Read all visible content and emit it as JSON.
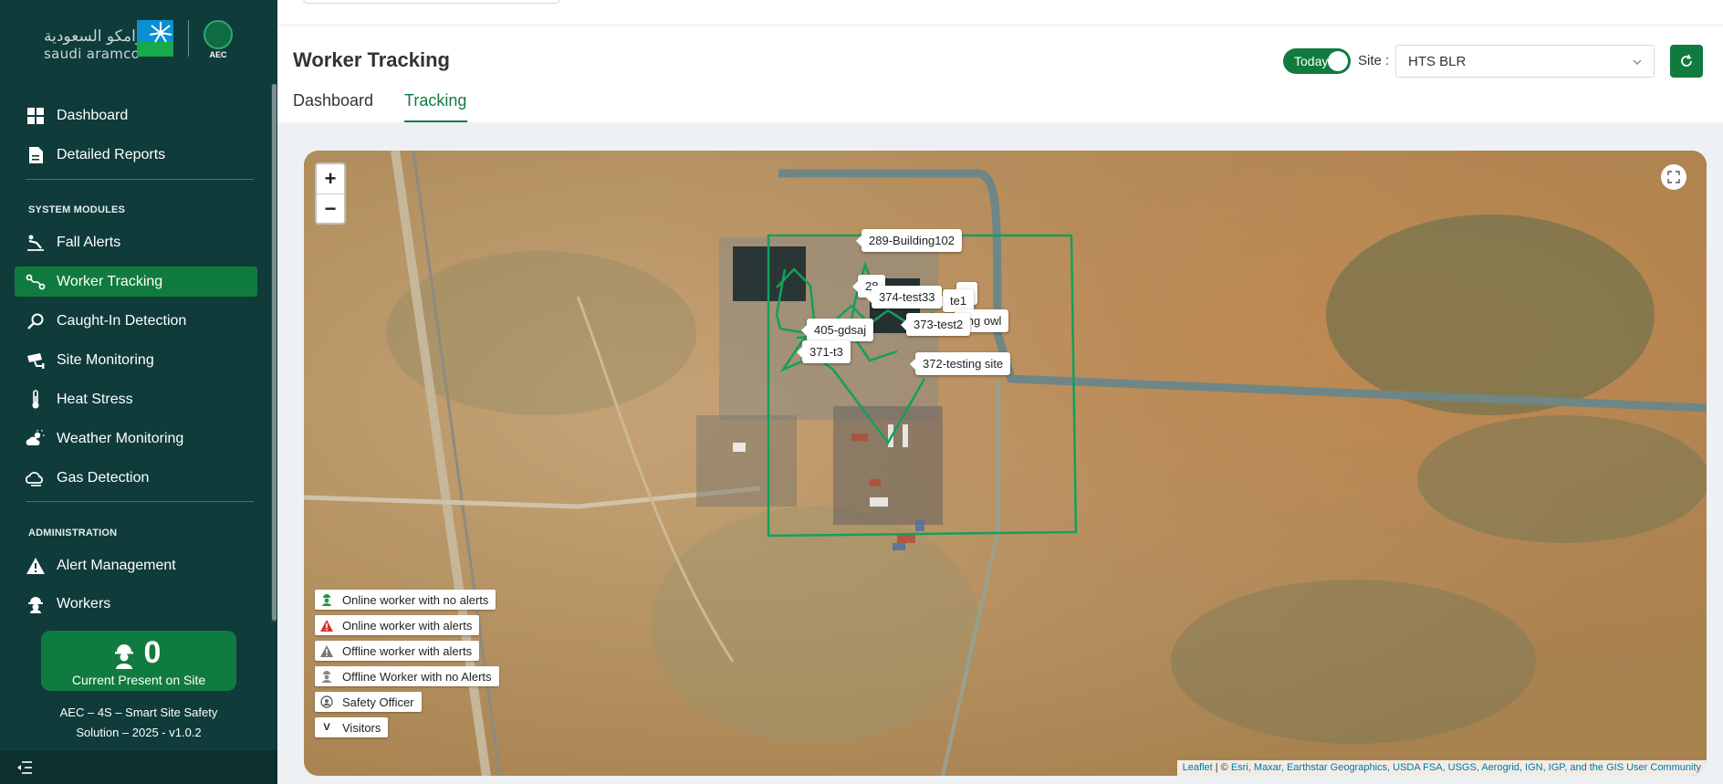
{
  "brand": {
    "aramco_arabic": "أرامكو السعودية",
    "aramco_english": "saudi aramco",
    "aec_text": "AEC"
  },
  "sidebar": {
    "primary_items": [
      {
        "label": "Dashboard",
        "icon": "dashboard-grid-icon"
      },
      {
        "label": "Detailed Reports",
        "icon": "report-document-icon"
      }
    ],
    "section_modules": "SYSTEM MODULES",
    "module_items": [
      {
        "label": "Fall Alerts",
        "icon": "fall-icon"
      },
      {
        "label": "Worker Tracking",
        "icon": "route-tracking-icon",
        "active": true
      },
      {
        "label": "Caught-In Detection",
        "icon": "magnifier-icon"
      },
      {
        "label": "Site Monitoring",
        "icon": "cctv-camera-icon"
      },
      {
        "label": "Heat Stress",
        "icon": "thermometer-icon"
      },
      {
        "label": "Weather Monitoring",
        "icon": "weather-sun-cloud-icon"
      },
      {
        "label": "Gas Detection",
        "icon": "gas-cloud-icon"
      }
    ],
    "section_admin": "ADMINISTRATION",
    "admin_items": [
      {
        "label": "Alert Management",
        "icon": "warning-triangle-icon"
      },
      {
        "label": "Workers",
        "icon": "hardhat-worker-icon"
      }
    ],
    "present": {
      "count": "0",
      "label": "Current Present on Site"
    },
    "footer_line1": "AEC – 4S – Smart Site Safety",
    "footer_line2": "Solution – 2025 - v1.0.2"
  },
  "header": {
    "title": "Worker Tracking",
    "tabs": [
      {
        "label": "Dashboard"
      },
      {
        "label": "Tracking",
        "active": true
      }
    ],
    "toggle_label": "Today",
    "toggle_on": true,
    "site_label": "Site :",
    "site_value": "HTS BLR"
  },
  "map": {
    "zoom_in": "+",
    "zoom_out": "−",
    "site_labels": [
      "289-Building102",
      "28",
      "374-test33",
      "a",
      "te1",
      "ling owl",
      "373-test2",
      "405-gdsaj",
      "371-t3",
      "372-testing site"
    ],
    "legend": [
      {
        "label": "Online worker with no alerts",
        "icon": "green-worker-icon",
        "color": "#1f9a3c"
      },
      {
        "label": "Online worker with alerts",
        "icon": "red-alert-icon",
        "color": "#d9342b"
      },
      {
        "label": "Offline worker with alerts",
        "icon": "grey-alert-icon",
        "color": "#777777"
      },
      {
        "label": "Offline Worker with no Alerts",
        "icon": "grey-worker-icon",
        "color": "#888888"
      },
      {
        "label": "Safety Officer",
        "icon": "safety-officer-icon",
        "color": "#666666"
      },
      {
        "label": "Visitors",
        "icon": "visitor-v-icon",
        "symbol": "V"
      }
    ],
    "attribution": {
      "leaflet": "Leaflet",
      "separator": " | © ",
      "sources": "Esri, Maxar, Earthstar Geographics, USDA FSA, USGS, Aerogrid, IGN, IGP, and the GIS User Community"
    }
  },
  "colors": {
    "sidebar_bg": "#0f3b3a",
    "accent_green": "#107b3f",
    "map_boundary": "#13a05a"
  }
}
